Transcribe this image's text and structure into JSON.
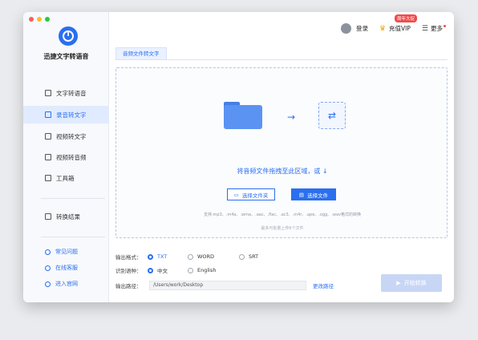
{
  "app": {
    "name": "迅捷文字转语音"
  },
  "sidebar": {
    "items": [
      {
        "label": "文字转语音"
      },
      {
        "label": "录音转文字"
      },
      {
        "label": "视频转文字"
      },
      {
        "label": "视频转音频"
      },
      {
        "label": "工具箱"
      }
    ],
    "results_label": "转换结果",
    "footer": [
      {
        "label": "常见问题"
      },
      {
        "label": "在线客服"
      },
      {
        "label": "进入官网"
      }
    ]
  },
  "topbar": {
    "login_label": "登录",
    "vip_label": "充值VIP",
    "vip_badge": "周年大促",
    "more_label": "更多"
  },
  "tab": {
    "label": "音频文件转文字"
  },
  "dropzone": {
    "title": "将音频文件拖拽至此区域，或",
    "select_folder_label": "选择文件夹",
    "select_file_label": "选择文件",
    "supported_text": "支持.mp3、.m4a、.wma、.aac、.flac、.ac3、.m4r、.ape、.ogg、.wav格式的转换",
    "max_text": "最多可批量上传6个文件"
  },
  "options": {
    "format_label": "输出格式：",
    "formats": [
      "TXT",
      "WORD",
      "SRT"
    ],
    "language_label": "识别语种：",
    "languages": [
      "中文",
      "English"
    ],
    "path_label": "输出路径：",
    "path_value": "/Users/work/Desktop",
    "change_path_label": "更改路径"
  },
  "start_button": {
    "label": "开始转换"
  },
  "colors": {
    "accent": "#2a6ff0",
    "disabled": "#c8d6f5",
    "badge": "#f24a4a"
  }
}
